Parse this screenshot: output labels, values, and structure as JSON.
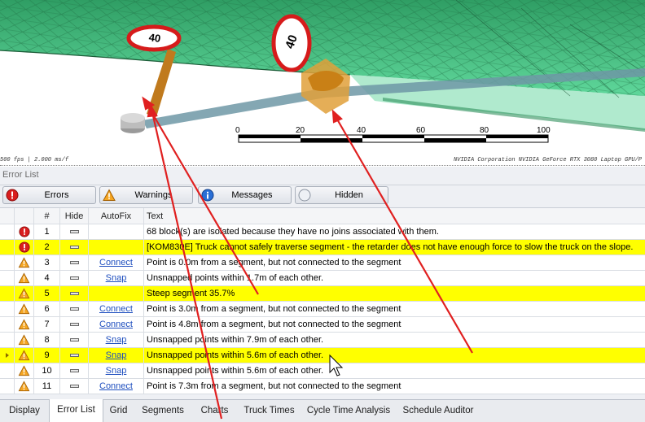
{
  "viewport": {
    "sign_left": "40",
    "sign_right": "40",
    "scale_labels": [
      "0",
      "20",
      "40",
      "60",
      "80",
      "100"
    ],
    "status_left": "500 fps | 2.000 ms/f",
    "status_right": "NVIDIA Corporation NVIDIA GeForce RTX 3080 Laptop GPU/P"
  },
  "panel": {
    "title": "Error List",
    "filters": [
      {
        "label": "Errors",
        "icon": "error-icon"
      },
      {
        "label": "Warnings",
        "icon": "warning-icon"
      },
      {
        "label": "Messages",
        "icon": "info-icon"
      },
      {
        "label": "Hidden",
        "icon": "hidden-circle-icon"
      }
    ]
  },
  "grid": {
    "columns": [
      "#",
      "Hide",
      "AutoFix",
      "Text"
    ],
    "rows": [
      {
        "num": "1",
        "severity": "error",
        "autofix": "",
        "text": "68 block(s) are isolated because they have no joins associated with them.",
        "highlight": false
      },
      {
        "num": "2",
        "severity": "error",
        "autofix": "",
        "text": "[KOM830E] Truck cannot safely traverse segment - the retarder does not have enough force to slow the truck on the slope.",
        "highlight": true
      },
      {
        "num": "3",
        "severity": "warning",
        "autofix": "Connect",
        "text": "Point is 0.0m from a segment, but not connected to the segment",
        "highlight": false
      },
      {
        "num": "4",
        "severity": "warning",
        "autofix": "Snap",
        "text": "Unsnapped points within 1.7m of each other.",
        "highlight": false
      },
      {
        "num": "5",
        "severity": "warning",
        "autofix": "",
        "text": "Steep segment 35.7%",
        "highlight": true
      },
      {
        "num": "6",
        "severity": "warning",
        "autofix": "Connect",
        "text": "Point is 3.0m from a segment, but not connected to the segment",
        "highlight": false
      },
      {
        "num": "7",
        "severity": "warning",
        "autofix": "Connect",
        "text": "Point is 4.8m from a segment, but not connected to the segment",
        "highlight": false
      },
      {
        "num": "8",
        "severity": "warning",
        "autofix": "Snap",
        "text": "Unsnapped points within 7.9m of each other.",
        "highlight": false
      },
      {
        "num": "9",
        "severity": "warning",
        "autofix": "Snap",
        "text": "Unsnapped points within 5.6m of each other.",
        "highlight": true,
        "current": true
      },
      {
        "num": "10",
        "severity": "warning",
        "autofix": "Snap",
        "text": "Unsnapped points within 5.6m of each other.",
        "highlight": false
      },
      {
        "num": "11",
        "severity": "warning",
        "autofix": "Connect",
        "text": "Point is 7.3m from a segment, but not connected to the segment",
        "highlight": false
      }
    ]
  },
  "tabs": {
    "items": [
      "Display",
      "Error List",
      "Grid",
      "Segments",
      "Charts",
      "Truck Times",
      "Cycle Time Analysis",
      "Schedule Auditor"
    ],
    "active": "Error List"
  },
  "colors": {
    "highlight": "#ffff00",
    "annotation_arrow": "#e02020",
    "terrain": "#3fbf7f",
    "link": "#1f4fbf"
  }
}
